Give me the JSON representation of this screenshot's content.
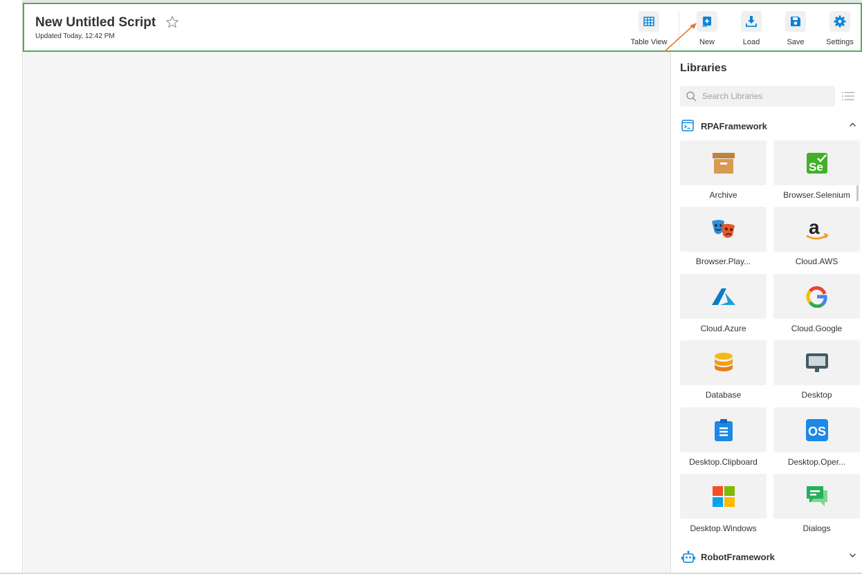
{
  "header": {
    "title": "New Untitled Script",
    "subtitle": "Updated Today, 12:42 PM",
    "toolbar": {
      "table_view": "Table View",
      "new": "New",
      "load": "Load",
      "save": "Save",
      "settings": "Settings"
    }
  },
  "sidebar": {
    "title": "Libraries",
    "search_placeholder": "Search Libraries",
    "sections": [
      {
        "label": "RPAFramework",
        "expanded": true,
        "icon": "terminal-icon"
      },
      {
        "label": "RobotFramework",
        "expanded": false,
        "icon": "robot-icon"
      }
    ],
    "libraries": [
      {
        "label": "Archive",
        "icon": "archive-icon"
      },
      {
        "label": "Browser.Selenium",
        "icon": "selenium-icon"
      },
      {
        "label": "Browser.Play...",
        "icon": "playwright-icon"
      },
      {
        "label": "Cloud.AWS",
        "icon": "amazon-icon"
      },
      {
        "label": "Cloud.Azure",
        "icon": "azure-icon"
      },
      {
        "label": "Cloud.Google",
        "icon": "google-icon"
      },
      {
        "label": "Database",
        "icon": "database-icon"
      },
      {
        "label": "Desktop",
        "icon": "monitor-icon"
      },
      {
        "label": "Desktop.Clipboard",
        "icon": "clipboard-icon"
      },
      {
        "label": "Desktop.Oper...",
        "icon": "os-icon"
      },
      {
        "label": "Desktop.Windows",
        "icon": "windows-icon"
      },
      {
        "label": "Dialogs",
        "icon": "chat-icon"
      }
    ]
  },
  "colors": {
    "accent": "#0a84d8",
    "header_border": "#4caf50",
    "arrow": "#e8772e"
  }
}
